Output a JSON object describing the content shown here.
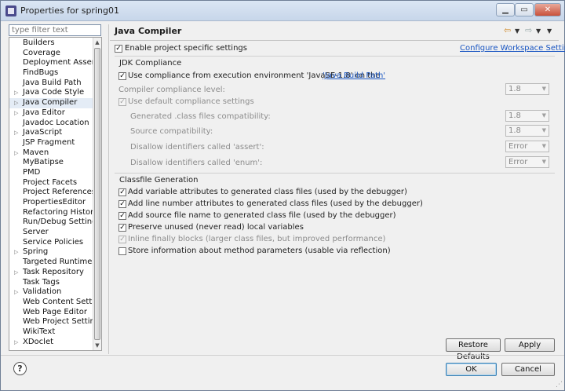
{
  "window": {
    "title": "Properties for spring01",
    "minimize_glyph": "▁",
    "maximize_glyph": "▭",
    "close_glyph": "✕"
  },
  "filter": {
    "placeholder": "type filter text"
  },
  "tree": {
    "items": [
      {
        "label": "Builders",
        "expandable": false
      },
      {
        "label": "Coverage",
        "expandable": false
      },
      {
        "label": "Deployment Assembly",
        "expandable": false
      },
      {
        "label": "FindBugs",
        "expandable": false
      },
      {
        "label": "Java Build Path",
        "expandable": false
      },
      {
        "label": "Java Code Style",
        "expandable": true
      },
      {
        "label": "Java Compiler",
        "expandable": true,
        "selected": true
      },
      {
        "label": "Java Editor",
        "expandable": true
      },
      {
        "label": "Javadoc Location",
        "expandable": false
      },
      {
        "label": "JavaScript",
        "expandable": true
      },
      {
        "label": "JSP Fragment",
        "expandable": false
      },
      {
        "label": "Maven",
        "expandable": true
      },
      {
        "label": "MyBatipse",
        "expandable": false
      },
      {
        "label": "PMD",
        "expandable": false
      },
      {
        "label": "Project Facets",
        "expandable": false
      },
      {
        "label": "Project References",
        "expandable": false
      },
      {
        "label": "PropertiesEditor",
        "expandable": false
      },
      {
        "label": "Refactoring History",
        "expandable": false
      },
      {
        "label": "Run/Debug Settings",
        "expandable": false
      },
      {
        "label": "Server",
        "expandable": false
      },
      {
        "label": "Service Policies",
        "expandable": false
      },
      {
        "label": "Spring",
        "expandable": true
      },
      {
        "label": "Targeted Runtimes",
        "expandable": false
      },
      {
        "label": "Task Repository",
        "expandable": true
      },
      {
        "label": "Task Tags",
        "expandable": false
      },
      {
        "label": "Validation",
        "expandable": true
      },
      {
        "label": "Web Content Settings",
        "expandable": false
      },
      {
        "label": "Web Page Editor",
        "expandable": false
      },
      {
        "label": "Web Project Settings",
        "expandable": false
      },
      {
        "label": "WikiText",
        "expandable": false
      },
      {
        "label": "XDoclet",
        "expandable": true
      }
    ]
  },
  "page": {
    "title": "Java Compiler",
    "nav_back": "⇦",
    "nav_forward": "⇨",
    "menu_glyph": "▼",
    "enable_project_specific": "Enable project specific settings",
    "configure_workspace": "Configure Workspace Settings..."
  },
  "jdk": {
    "group_title": "JDK Compliance",
    "use_env_prefix": "Use compliance from execution environment 'JavaSE-1.8' on the ",
    "use_env_link": "'Java Build Path'",
    "compliance_level_label": "Compiler compliance level:",
    "compliance_level_value": "1.8",
    "use_default_label": "Use default compliance settings",
    "generated_label": "Generated .class files compatibility:",
    "generated_value": "1.8",
    "source_label": "Source compatibility:",
    "source_value": "1.8",
    "assert_label": "Disallow identifiers called 'assert':",
    "assert_value": "Error",
    "enum_label": "Disallow identifiers called 'enum':",
    "enum_value": "Error"
  },
  "classfile": {
    "group_title": "Classfile Generation",
    "options": [
      {
        "label": "Add variable attributes to generated class files (used by the debugger)",
        "checked": true,
        "enabled": true
      },
      {
        "label": "Add line number attributes to generated class files (used by the debugger)",
        "checked": true,
        "enabled": true
      },
      {
        "label": "Add source file name to generated class file (used by the debugger)",
        "checked": true,
        "enabled": true
      },
      {
        "label": "Preserve unused (never read) local variables",
        "checked": true,
        "enabled": true
      },
      {
        "label": "Inline finally blocks (larger class files, but improved performance)",
        "checked": true,
        "enabled": false
      },
      {
        "label": "Store information about method parameters (usable via reflection)",
        "checked": false,
        "enabled": true
      }
    ]
  },
  "buttons": {
    "restore_defaults": "Restore Defaults",
    "apply": "Apply",
    "ok": "OK",
    "cancel": "Cancel",
    "help": "?"
  }
}
